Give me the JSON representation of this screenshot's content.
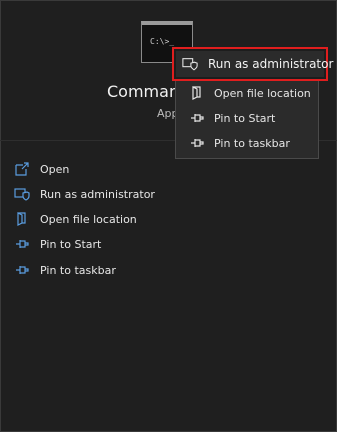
{
  "app": {
    "name": "Command",
    "type": "App",
    "prompt": "C:\\>_"
  },
  "actions": [
    {
      "label": "Open",
      "icon": "open-icon"
    },
    {
      "label": "Run as administrator",
      "icon": "shield-icon"
    },
    {
      "label": "Open file location",
      "icon": "folder-icon"
    },
    {
      "label": "Pin to Start",
      "icon": "pin-icon"
    },
    {
      "label": "Pin to taskbar",
      "icon": "pin-icon"
    }
  ],
  "context_menu": {
    "highlighted": {
      "label": "Run as administrator",
      "icon": "shield-icon"
    },
    "items": [
      {
        "label": "Open file location",
        "icon": "folder-icon"
      },
      {
        "label": "Pin to Start",
        "icon": "pin-icon"
      },
      {
        "label": "Pin to taskbar",
        "icon": "pin-icon"
      }
    ]
  },
  "colors": {
    "background": "#1f1f1f",
    "menu": "#2b2b2b",
    "accent": "#4f8fd6",
    "highlight_border": "#e01e1e"
  }
}
